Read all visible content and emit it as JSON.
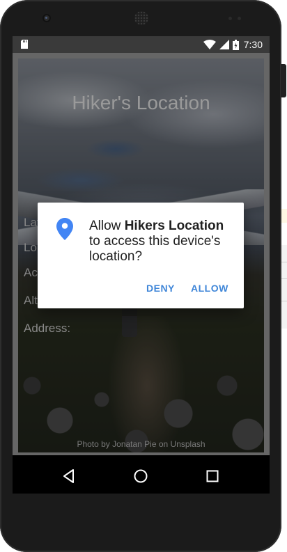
{
  "status_bar": {
    "time": "7:30",
    "icons": [
      "sd-card-icon",
      "wifi-icon",
      "signal-icon",
      "battery-icon"
    ]
  },
  "app": {
    "title": "Hiker's Location",
    "fields": [
      "Latitude:",
      "Longitude:",
      "Accuracy:",
      "Altitude:",
      "Address:"
    ],
    "photo_credit": "Photo by Jonatan Pie on Unsplash"
  },
  "dialog": {
    "icon": "location-pin-icon",
    "message_prefix": "Allow ",
    "app_name": "Hikers Location",
    "message_suffix": " to access this device's location?",
    "deny_label": "DENY",
    "allow_label": "ALLOW"
  },
  "nav_bar": {
    "icons": [
      "back-icon",
      "home-icon",
      "recents-icon"
    ]
  },
  "colors": {
    "accent": "#3f86d8",
    "pin": "#4285f4",
    "status_bar": "#3a3a3a"
  }
}
